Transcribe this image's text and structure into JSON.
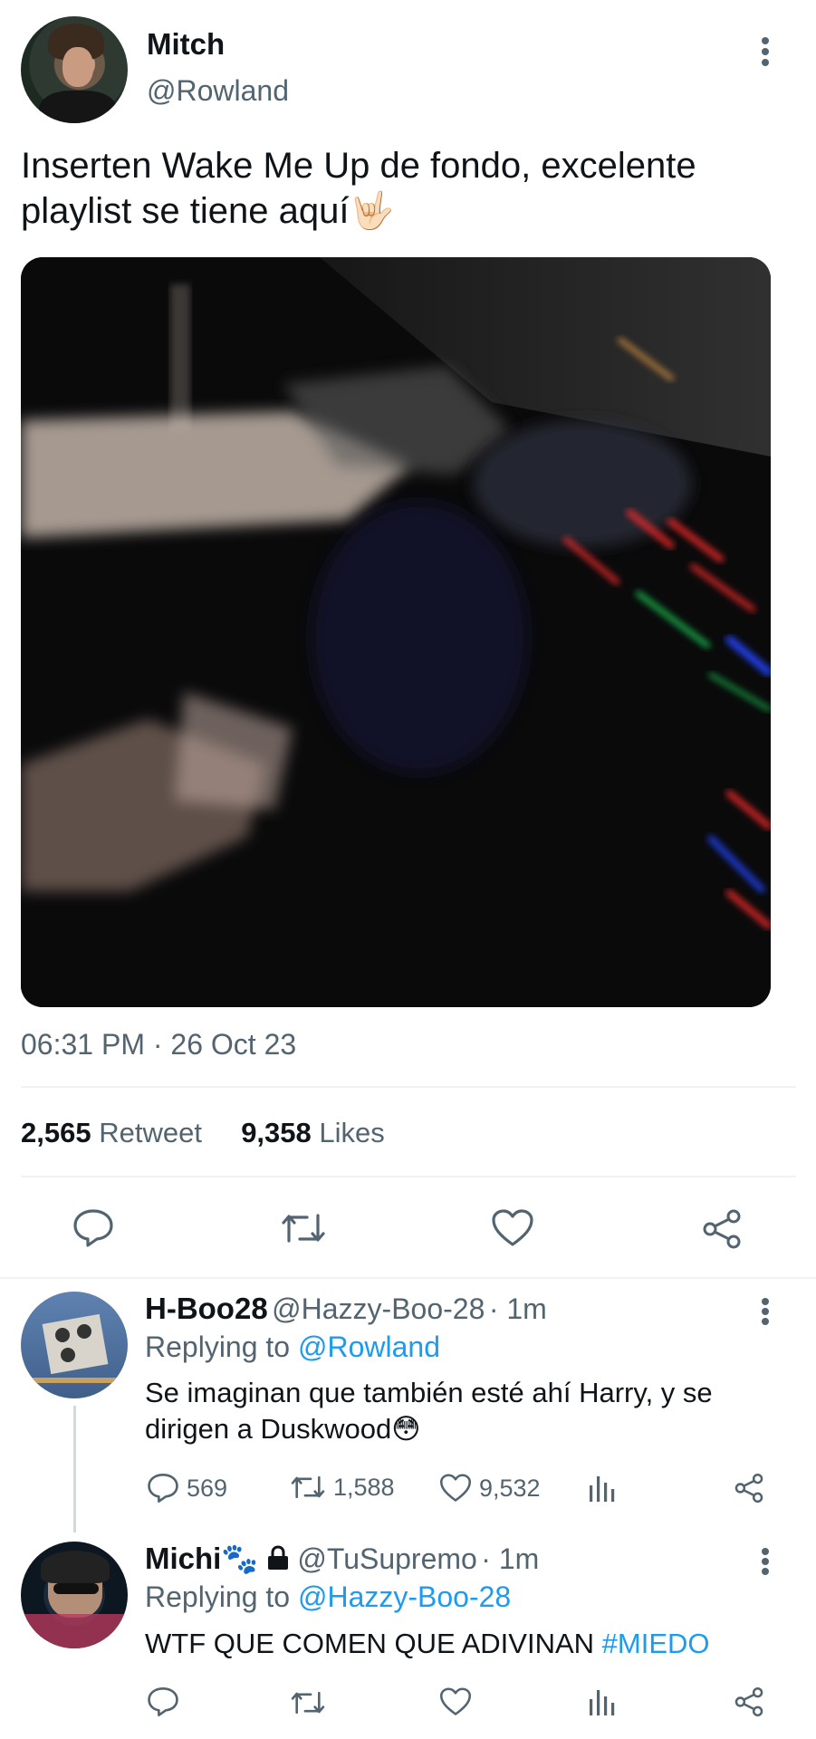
{
  "tweet": {
    "author_name": "Mitch",
    "author_handle": "@Rowland",
    "text": "Inserten Wake Me Up de fondo, excelente playlist se tiene aquí🤟🏻",
    "timestamp": "06:31 PM · 26 Oct 23",
    "retweets_count": "2,565",
    "retweets_label": "Retweet",
    "likes_count": "9,358",
    "likes_label": "Likes"
  },
  "replies": [
    {
      "name": "H-Boo28",
      "handle": "@Hazzy-Boo-28",
      "time": "· 1m",
      "replying_prefix": "Replying to",
      "replying_to": "@Rowland",
      "text": "Se imaginan que también esté ahí Harry, y se dirigen a Duskwood😳",
      "reply_count": "569",
      "retweet_count": "1,588",
      "like_count": "9,532"
    },
    {
      "name": "Michi🐾",
      "handle": "@TuSupremo",
      "time": "· 1m",
      "replying_prefix": "Replying to",
      "replying_to": "@Hazzy-Boo-28",
      "text": "WTF QUE COMEN QUE ADIVINAN",
      "hashtag": "#MIEDO"
    }
  ],
  "icons": [
    "more-vertical-icon",
    "reply-icon",
    "retweet-icon",
    "heart-icon",
    "share-icon",
    "analytics-icon",
    "lock-icon"
  ],
  "colors": {
    "accent": "#1d9bf0",
    "secondary_text": "#536471",
    "divider": "#eff3f4"
  }
}
